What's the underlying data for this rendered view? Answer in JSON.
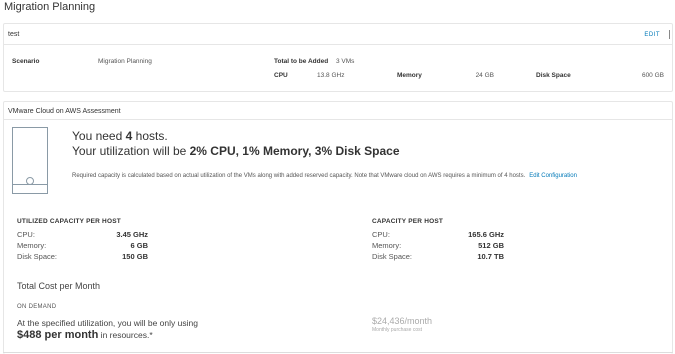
{
  "page": {
    "title": "Migration Planning"
  },
  "plan_card": {
    "name": "test",
    "edit_label": "EDIT",
    "scenario_label": "Scenario",
    "scenario_value": "Migration Planning",
    "total_label": "Total to be Added",
    "total_value": "3 VMs",
    "cpu_label": "CPU",
    "cpu_value": "13.8 GHz",
    "memory_label": "Memory",
    "memory_value": "24 GB",
    "disk_label": "Disk Space",
    "disk_value": "600 GB"
  },
  "assessment": {
    "title": "VMware Cloud on AWS Assessment",
    "need_prefix": "You need ",
    "hosts_count": "4",
    "need_suffix": " hosts.",
    "util_prefix": "Your utilization will be ",
    "util_values": "2% CPU, 1% Memory, 3% Disk Space",
    "note": "Required capacity is calculated based on actual utilization of the VMs along with added reserved capacity. Note that VMware cloud on AWS requires a minimum of 4 hosts.",
    "edit_config_label": "Edit Configuration",
    "utilized": {
      "heading": "UTILIZED CAPACITY PER HOST",
      "rows": [
        {
          "label": "CPU:",
          "value": "3.45 GHz"
        },
        {
          "label": "Memory:",
          "value": "6 GB"
        },
        {
          "label": "Disk Space:",
          "value": "150 GB"
        }
      ]
    },
    "capacity": {
      "heading": "CAPACITY PER HOST",
      "rows": [
        {
          "label": "CPU:",
          "value": "165.6 GHz"
        },
        {
          "label": "Memory:",
          "value": "512 GB"
        },
        {
          "label": "Disk Space:",
          "value": "10.7 TB"
        }
      ]
    },
    "cost": {
      "title": "Total Cost per Month",
      "mode": "ON DEMAND",
      "util_text": "At the specified utilization, you will be only using",
      "price": "$488 per month",
      "price_suffix": " in resources.*",
      "monthly_price": "$24,436/month",
      "monthly_sub": "Monthly purchase cost"
    }
  }
}
